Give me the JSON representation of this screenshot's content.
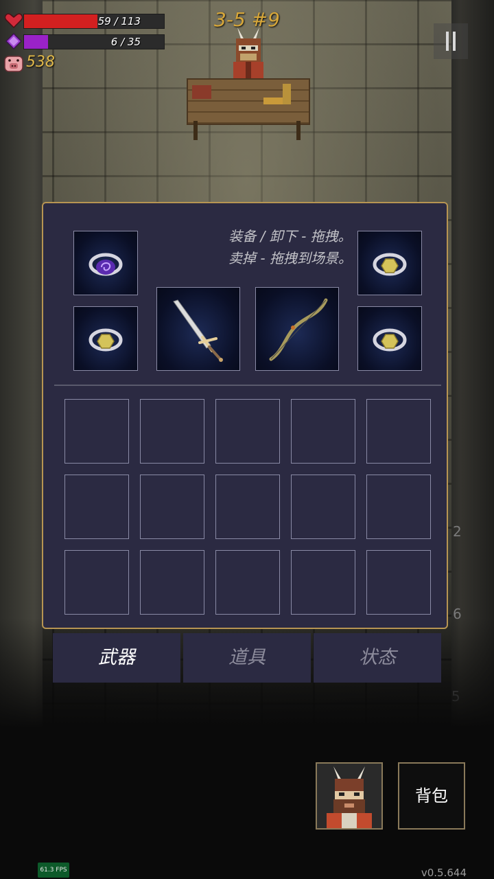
{
  "hud": {
    "health": {
      "current": 59,
      "max": 113,
      "text": "59 / 113",
      "color": "#d32020"
    },
    "mana": {
      "current": 6,
      "max": 35,
      "text": "6 / 35",
      "color": "#9a22c8"
    },
    "coins": "538",
    "level": "3-5 #9"
  },
  "inventory": {
    "hint_line1": "装备 / 卸下 - 拖拽。",
    "hint_line2": "卖掉 - 拖拽到场景。",
    "equipped": {
      "ring_top_left": "purple-swirl-ring",
      "ring_bottom_left": "gold-gem-ring",
      "ring_top_right": "gold-gem-ring",
      "ring_bottom_right": "gold-gem-ring",
      "weapon": "longsword",
      "offhand": "wooden-bow"
    },
    "grid_slots": 15
  },
  "tabs": [
    {
      "label": "武器",
      "active": true
    },
    {
      "label": "道具",
      "active": false
    },
    {
      "label": "状态",
      "active": false
    }
  ],
  "side_numbers": [
    "2",
    "6",
    "5"
  ],
  "buttons": {
    "backpack": "背包"
  },
  "fps": "61.3 FPS",
  "version": "v0.5.644"
}
